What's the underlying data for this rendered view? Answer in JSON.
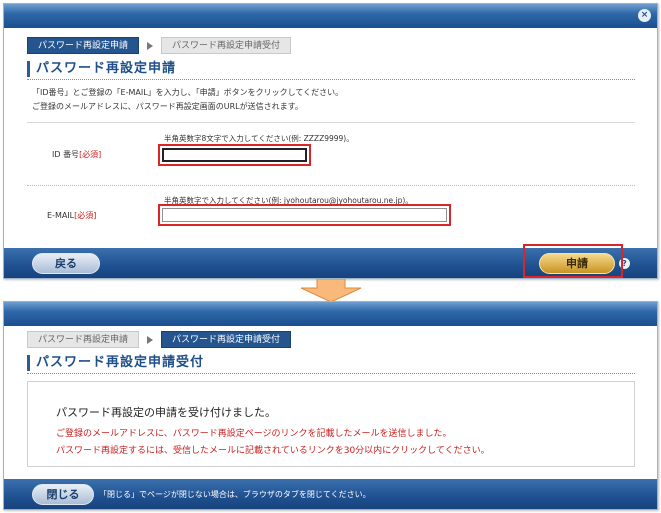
{
  "screen1": {
    "close_glyph": "×",
    "steps": [
      {
        "label": "パスワード再設定申請",
        "state": "active"
      },
      {
        "label": "パスワード再設定申請受付",
        "state": "inactive"
      }
    ],
    "title": "パスワード再設定申請",
    "description": [
      "「ID番号」とご登録の「E-MAIL」を入力し、「申請」ボタンをクリックしてください。",
      "ご登録のメールアドレスに、パスワード再設定画面のURLが送信されます。"
    ],
    "id_field": {
      "label": "ID 番号",
      "required": "[必須]",
      "hint": "半角英数字8文字で入力してください(例: ZZZZ9999)。",
      "value": "",
      "placeholder": ""
    },
    "email_field": {
      "label": "E-MAIL",
      "required": "[必須]",
      "hint": "半角英数字で入力してください(例: jyohoutarou@jyohoutarou.ne.jp)。",
      "value": "",
      "placeholder": ""
    },
    "back_button": "戻る",
    "submit_button": "申請",
    "help_icon_label": "?"
  },
  "screen2": {
    "steps": [
      {
        "label": "パスワード再設定申請",
        "state": "inactive"
      },
      {
        "label": "パスワード再設定申請受付",
        "state": "active"
      }
    ],
    "title": "パスワード再設定申請受付",
    "message_title": "パスワード再設定の申請を受け付けました。",
    "message_lines": [
      "ご登録のメールアドレスに、パスワード再設定ページのリンクを記載したメールを送信しました。",
      "パスワード再設定するには、受信したメールに記載されているリンクを30分以内にクリックしてください。"
    ],
    "close_button": "閉じる",
    "close_note": "「閉じる」でページが閉じない場合は、ブラウザのタブを閉じてください。"
  },
  "colors": {
    "primary": "#1e4f8a",
    "required": "#d0201e",
    "highlight_outline": "#d8262a",
    "submit_gold": "#d9a63a",
    "arrow_orange": "#f8b97a"
  },
  "icons": {
    "window_close": "close-icon",
    "help": "help-icon",
    "step_separator": "chevron-right-icon",
    "flow": "arrow-down-icon"
  }
}
